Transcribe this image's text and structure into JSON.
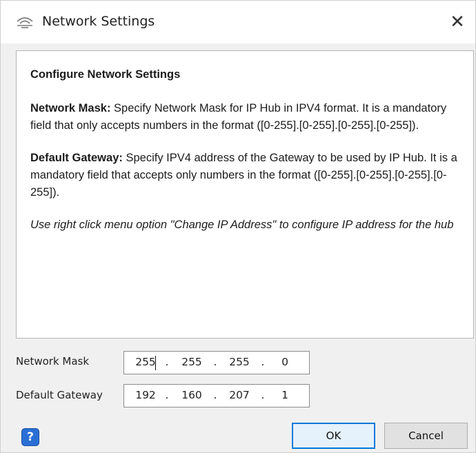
{
  "window": {
    "title": "Network Settings",
    "close_glyph": "✕"
  },
  "info": {
    "heading": "Configure Network Settings",
    "mask_label": "Network Mask:",
    "mask_text": " Specify Network Mask for IP Hub in IPV4 format. It is a mandatory field that only accepts numbers in the format ([0-255].[0-255].[0-255].[0-255]).",
    "gateway_label": "Default Gateway:",
    "gateway_text": " Specify IPV4 address of the Gateway to be used by IP Hub. It is a mandatory field that accepts only numbers in the format ([0-255].[0-255].[0-255].[0-255]).",
    "note": "Use right click menu option \"Change IP Address\" to configure IP address for the hub"
  },
  "form": {
    "network_mask": {
      "label": "Network Mask",
      "octets": [
        "255",
        "255",
        "255",
        "0"
      ]
    },
    "default_gateway": {
      "label": "Default Gateway",
      "octets": [
        "192",
        "160",
        "207",
        "1"
      ]
    },
    "separator": "."
  },
  "buttons": {
    "help": "?",
    "ok": "OK",
    "cancel": "Cancel"
  },
  "colors": {
    "accent": "#0078d7",
    "help_button": "#2a6fd6"
  },
  "icons": {
    "title": "network-icon",
    "close": "close-icon",
    "help": "help-icon"
  }
}
